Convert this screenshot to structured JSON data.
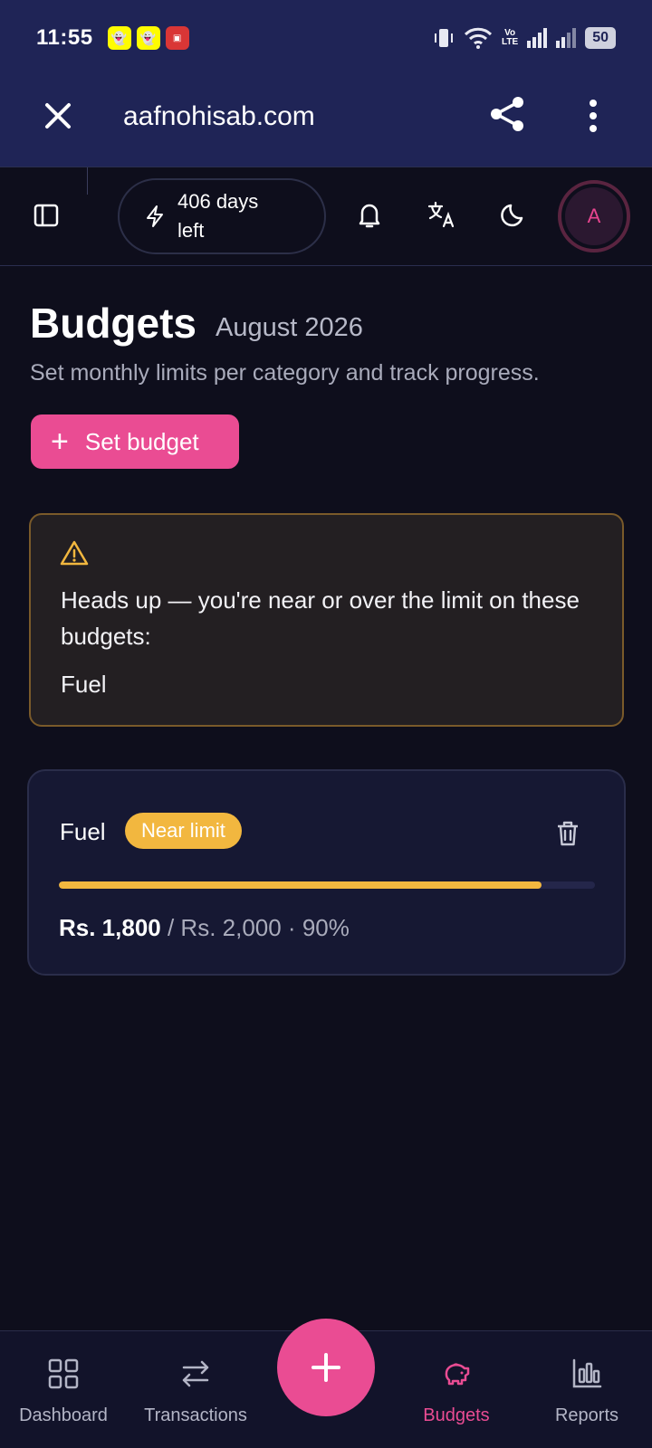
{
  "status_bar": {
    "time": "11:55",
    "battery": "50"
  },
  "browser": {
    "url": "aafnohisab.com"
  },
  "header": {
    "days_left": "406 days left",
    "avatar_initial": "A"
  },
  "page": {
    "title": "Budgets",
    "month": "August 2026",
    "description": "Set monthly limits per category and track progress.",
    "set_budget_label": "Set budget"
  },
  "alert": {
    "message": "Heads up — you're near or over the limit on these budgets:",
    "items": [
      "Fuel"
    ]
  },
  "budgets": [
    {
      "name": "Fuel",
      "status": "Near limit",
      "spent": "Rs. 1,800",
      "limit_text": " / Rs. 2,000 · 90%",
      "progress": 0.9
    }
  ],
  "nav": {
    "items": [
      {
        "label": "Dashboard"
      },
      {
        "label": "Transactions"
      },
      {
        "label": "Budgets"
      },
      {
        "label": "Reports"
      }
    ],
    "active": "Budgets"
  },
  "colors": {
    "accent": "#ea4c93",
    "warning": "#f2b73f",
    "background": "#0e0e1c",
    "browser_bar": "#1f2456"
  }
}
